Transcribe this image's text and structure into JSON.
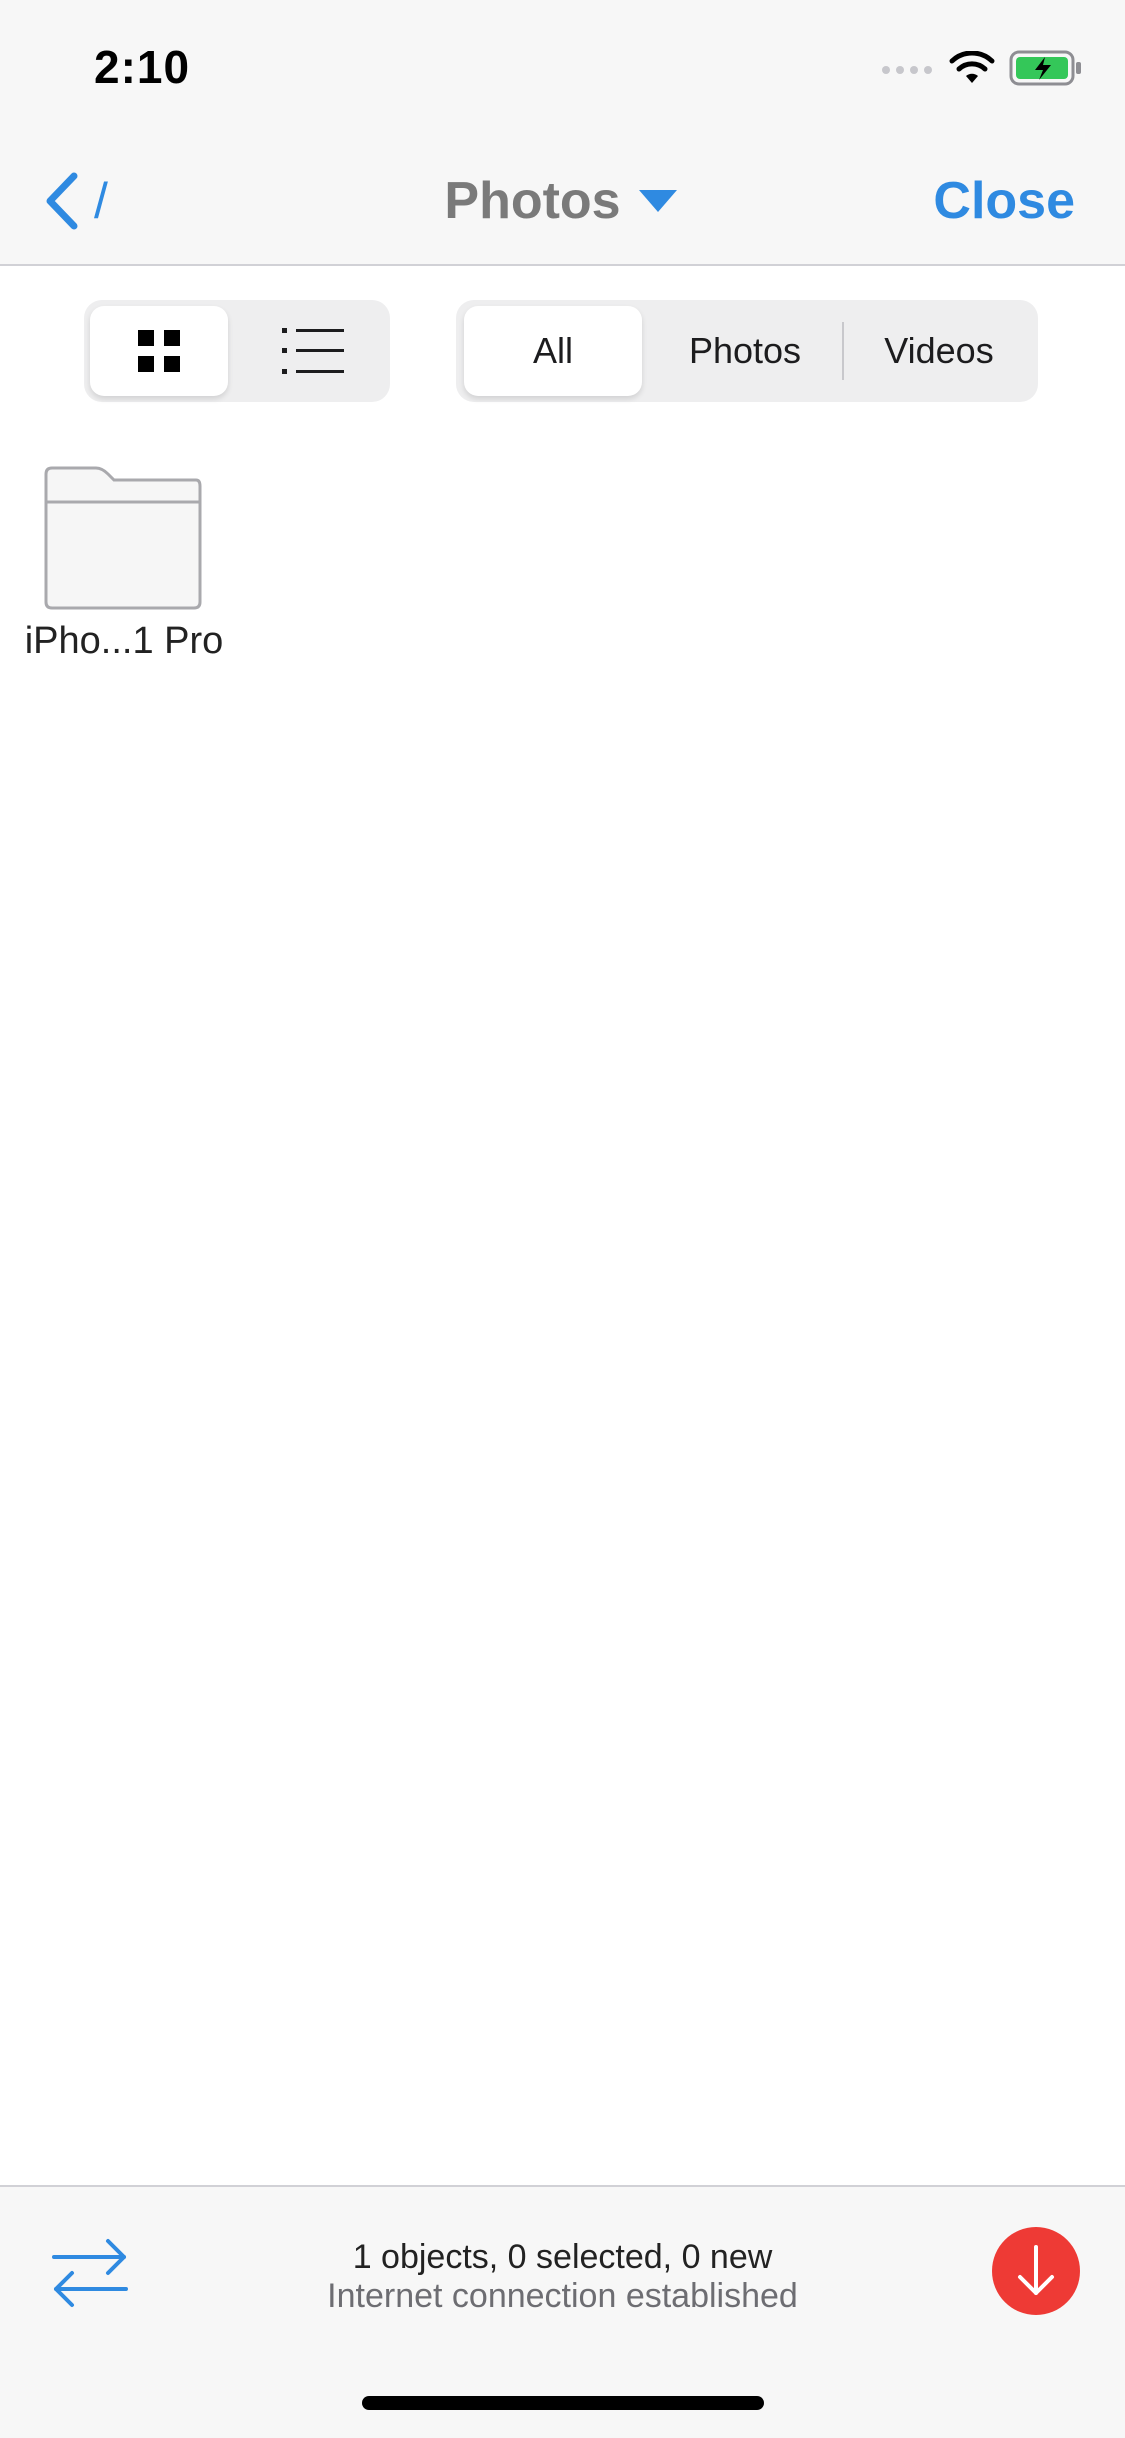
{
  "status_bar": {
    "time": "2:10"
  },
  "nav": {
    "back_path": "/",
    "title": "Photos",
    "close_label": "Close"
  },
  "view_toggle": {
    "selected": "grid"
  },
  "filter": {
    "options": [
      "All",
      "Photos",
      "Videos"
    ],
    "selected": "All"
  },
  "items": [
    {
      "name": "iPho...1 Pro",
      "type": "folder"
    }
  ],
  "toolbar": {
    "count_text": "1 objects, 0 selected, 0 new",
    "status_text": "Internet connection established"
  },
  "colors": {
    "accent": "#2f8ae1",
    "download": "#ee3a35",
    "battery": "#34c759"
  }
}
